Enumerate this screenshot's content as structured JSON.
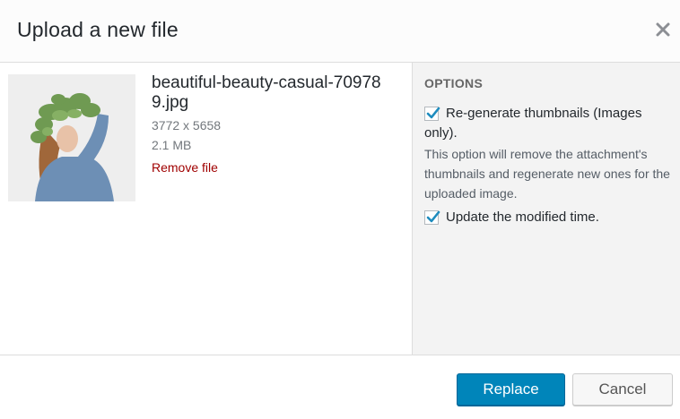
{
  "dialog": {
    "title": "Upload a new file"
  },
  "file": {
    "name": "beautiful-beauty-casual-709789.jpg",
    "dimensions": "3772 x 5658",
    "size": "2.1 MB",
    "remove_label": "Remove file"
  },
  "options": {
    "heading": "OPTIONS",
    "regenerate_label": "Re-generate thumbnails (Images only).",
    "regenerate_checked": true,
    "regenerate_description": "This option will remove the attachment's thumbnails and regenerate new ones for the uploaded image.",
    "update_time_label": "Update the modified time.",
    "update_time_checked": true
  },
  "buttons": {
    "replace_label": "Replace",
    "cancel_label": "Cancel"
  },
  "colors": {
    "primary": "#0085ba",
    "checkmark": "#1e8cbe",
    "danger": "#a00000"
  },
  "icons": {
    "close": "close-icon",
    "checkbox": "checkmark-icon"
  }
}
